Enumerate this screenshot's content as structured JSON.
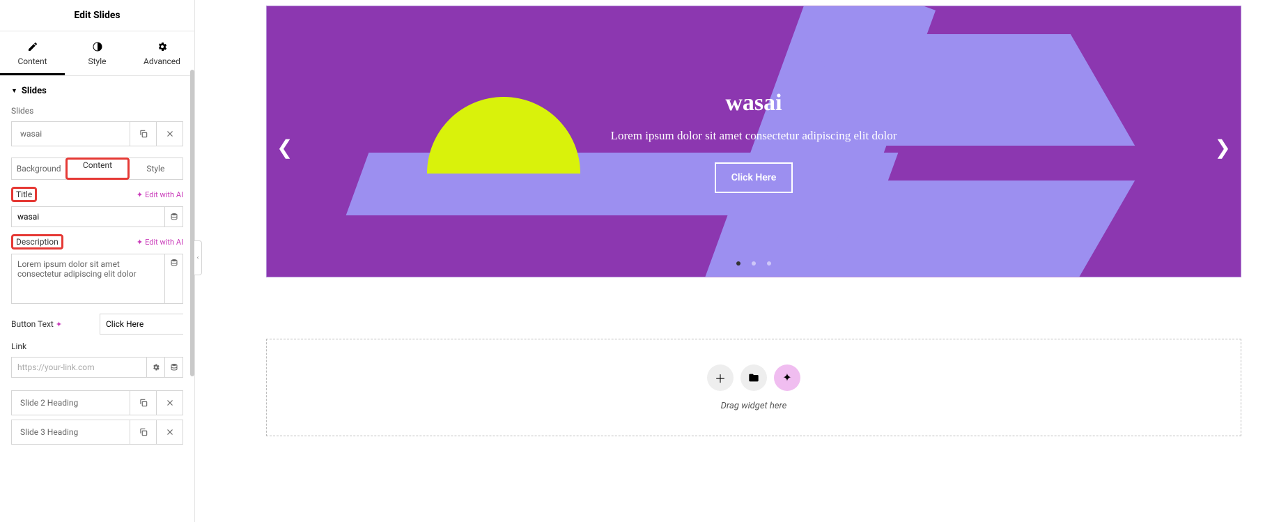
{
  "header": {
    "title": "Edit Slides"
  },
  "main_tabs": {
    "content": "Content",
    "style": "Style",
    "advanced": "Advanced"
  },
  "section": {
    "title": "Slides",
    "label": "Slides"
  },
  "slides_list": [
    {
      "name": "wasai"
    },
    {
      "name": "Slide 2 Heading"
    },
    {
      "name": "Slide 3 Heading"
    }
  ],
  "inner_tabs": {
    "background": "Background",
    "content": "Content",
    "style": "Style"
  },
  "fields": {
    "title_label": "Title",
    "title_value": "wasai",
    "description_label": "Description",
    "description_value": "Lorem ipsum dolor sit amet consectetur adipiscing elit dolor",
    "button_text_label": "Button Text",
    "button_text_value": "Click Here",
    "link_label": "Link",
    "link_placeholder": "https://your-link.com",
    "edit_with_ai": "Edit with AI"
  },
  "preview": {
    "title": "wasai",
    "description": "Lorem ipsum dolor sit amet consectetur adipiscing elit dolor",
    "button": "Click Here"
  },
  "dropzone": {
    "text": "Drag widget here"
  }
}
